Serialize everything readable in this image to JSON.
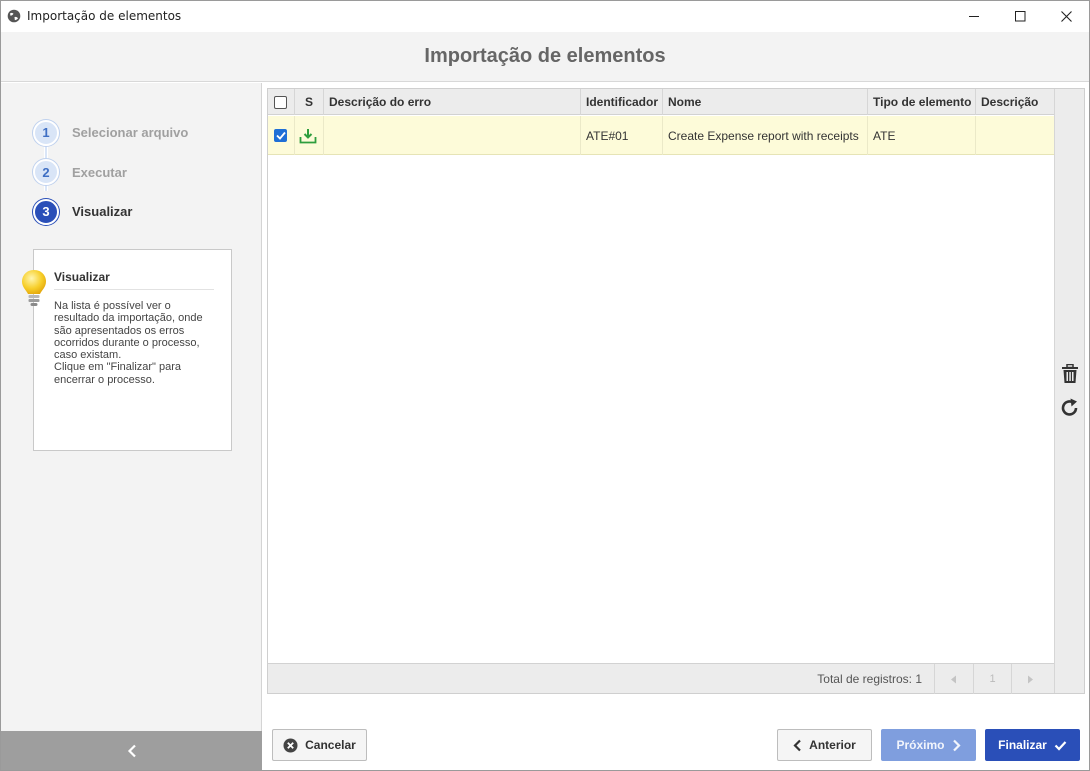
{
  "window": {
    "title": "Importação de elementos",
    "icon": "globe-icon",
    "controls": [
      "minimize-icon",
      "maximize-icon",
      "close-icon"
    ]
  },
  "header": {
    "title": "Importação de elementos"
  },
  "wizard": {
    "steps": [
      {
        "number": "1",
        "label": "Selecionar arquivo",
        "state": "done"
      },
      {
        "number": "2",
        "label": "Executar",
        "state": "done"
      },
      {
        "number": "3",
        "label": "Visualizar",
        "state": "active"
      }
    ],
    "help": {
      "icon": "lightbulb-icon",
      "title": "Visualizar",
      "text": "Na lista é possível ver o\nresultado da importação, onde\nsão apresentados os erros\nocorridos durante o processo,\ncaso existam.\nClique em \"Finalizar\" para\nencerrar o processo."
    },
    "collapse_icon": "chevron-left-icon"
  },
  "grid": {
    "columns": [
      "",
      "S",
      "Descrição do erro",
      "Identificador",
      "Nome",
      "Tipo de elemento",
      "Descrição"
    ],
    "rows": [
      {
        "checked": true,
        "status_icon": "import-success-icon",
        "error_description": "",
        "identifier": "ATE#01",
        "name": "Create Expense report with receipts",
        "element_type": "ATE",
        "description": ""
      }
    ],
    "side_tools": [
      "trash-icon",
      "refresh-icon"
    ],
    "footer": {
      "total_label": "Total de registros: 1",
      "page": "1"
    }
  },
  "buttons": {
    "cancel": "Cancelar",
    "previous": "Anterior",
    "next": "Próximo",
    "finish": "Finalizar"
  },
  "colors": {
    "primary": "#2a4fb8",
    "primary_disabled": "#7f9ede",
    "row_highlight": "#fdfbd9",
    "success_green": "#2e9e3e"
  }
}
